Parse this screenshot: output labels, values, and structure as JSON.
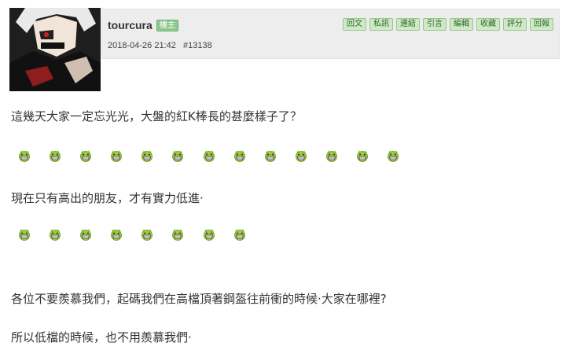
{
  "post": {
    "username": "tourcura",
    "role_badge": "樓主",
    "timestamp": "2018-04-26 21:42",
    "post_number": "#13138",
    "actions": [
      "回文",
      "私訊",
      "連結",
      "引言",
      "編輯",
      "收藏",
      "評分",
      "回報"
    ],
    "avatar_icon": "anime-character-avatar"
  },
  "content": {
    "line1": "這幾天大家一定忘光光，大盤的紅K棒長的甚麼樣子了？",
    "line2": "現在只有高出的朋友，才有實力低進‧",
    "line3": "各位不要羨慕我們，起碼我們在高檔頂著鋼盔往前衝的時候‧大家在哪裡?",
    "line4": "所以低檔的時候，也不用羨慕我們‧",
    "emoji_row1_count": 13,
    "emoji_row2_count": 8,
    "emoji_icon": "green-grin-emoticon"
  },
  "colors": {
    "meta_bg": "#ededed",
    "badge_green": "#8fc88f",
    "button_green": "#cfe8c5",
    "emoji_green": "#9ccc3c"
  }
}
